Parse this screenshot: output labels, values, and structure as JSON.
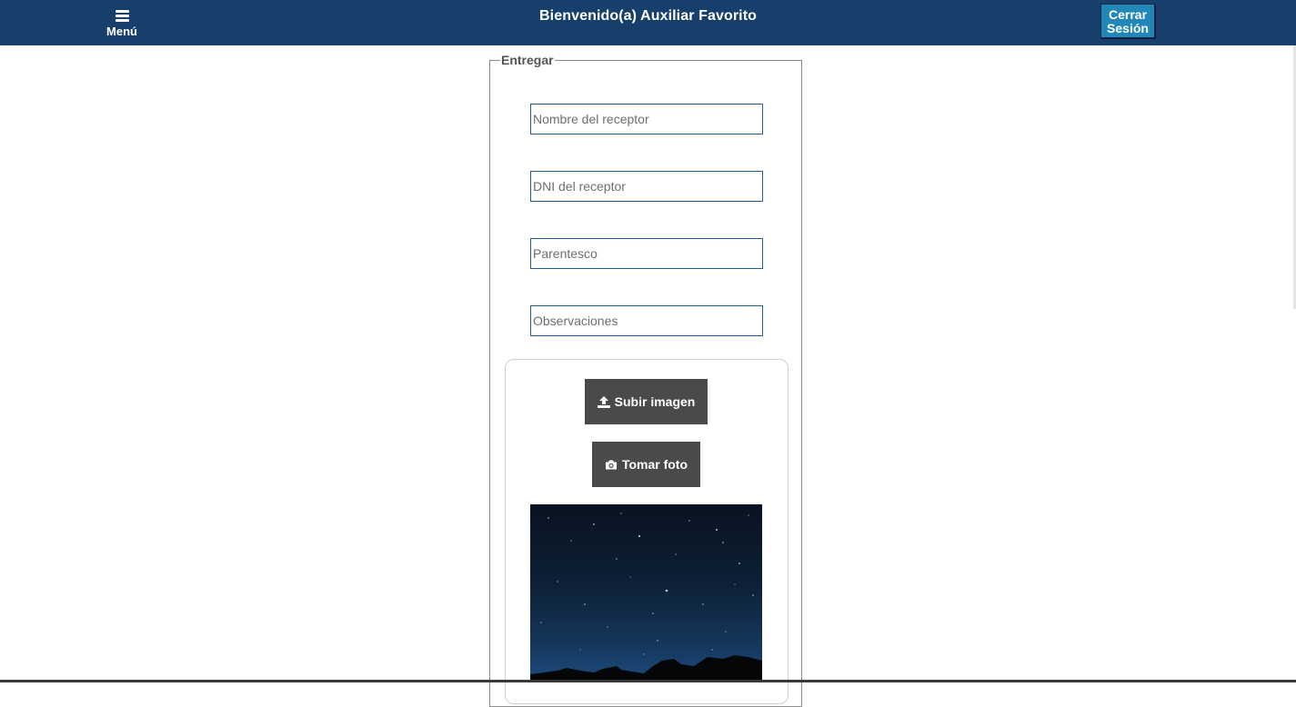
{
  "header": {
    "menu_label": "Menú",
    "title": "Bienvenido(a) Auxiliar Favorito",
    "logout_line1": "Cerrar",
    "logout_line2": "Sesión"
  },
  "form": {
    "legend": "Entregar",
    "fields": [
      {
        "placeholder": "Nombre del receptor",
        "value": ""
      },
      {
        "placeholder": "DNI del receptor",
        "value": ""
      },
      {
        "placeholder": "Parentesco",
        "value": ""
      },
      {
        "placeholder": "Observaciones",
        "value": ""
      }
    ],
    "upload_label": "Subir imagen",
    "upload_icon": "upload-icon",
    "camera_label": "Tomar foto",
    "camera_icon": "camera-icon"
  },
  "colors": {
    "header_bg": "#173f6b",
    "logout_bg": "#2187b8",
    "button_bg": "#4a4a4a",
    "field_border": "#1d5d9a"
  }
}
